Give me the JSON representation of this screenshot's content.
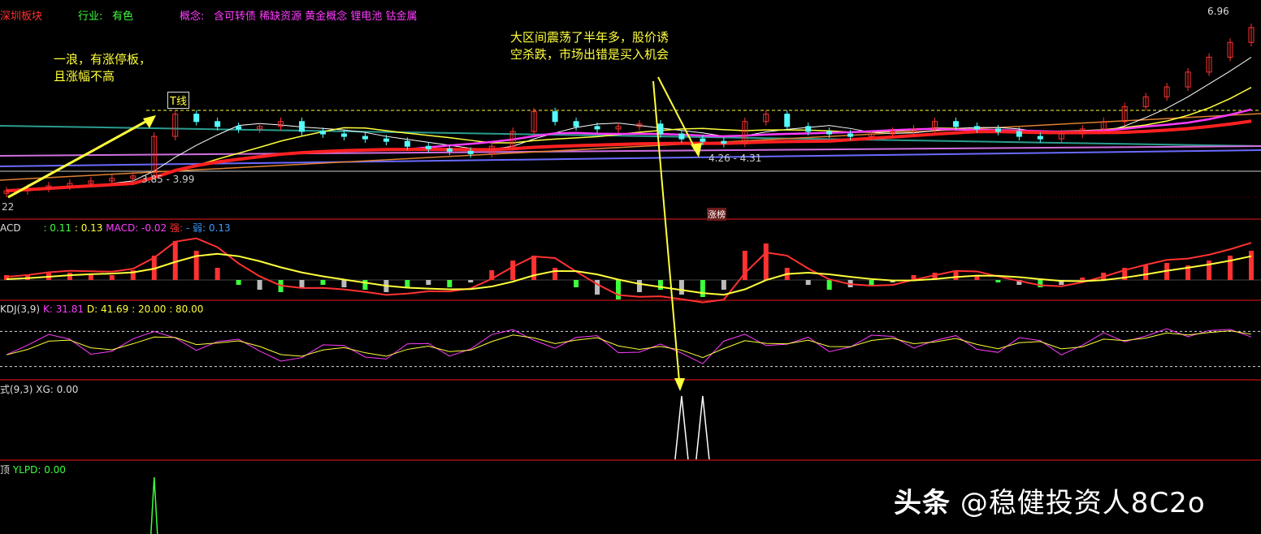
{
  "header": {
    "board": "深圳板块",
    "industry_label": "行业:",
    "industry": "有色",
    "concept_label": "概念:",
    "concepts": "含可转债 稀缺资源 黄金概念 锂电池 钴金属"
  },
  "annotations": {
    "wave_note": "一浪，有涨停板，\n且涨幅不高",
    "range_note": "大区间震荡了半年多，股价诱\n空杀跌，市场出错是买入机会",
    "t_line": "T线",
    "range_low_1": "3.85 - 3.99",
    "range_low_2": "4.26 - 4.31",
    "high_price": "6.96",
    "low_price": "22",
    "limit_up_badge": "涨榜",
    "watermark_bold": "头条",
    "watermark": "@稳健投资人8C2o"
  },
  "colors": {
    "up": "#ff3232",
    "down": "#54fcfc",
    "bg": "#000000",
    "separator": "#8b0000",
    "annotation": "#ffff3c"
  },
  "chart_data": [
    {
      "type": "candlestick",
      "panel": "main",
      "ylim": [
        3.22,
        6.96
      ],
      "close": [
        3.3,
        3.35,
        3.4,
        3.45,
        3.5,
        3.55,
        3.6,
        4.4,
        4.85,
        4.7,
        4.6,
        4.55,
        4.6,
        4.7,
        4.5,
        4.45,
        4.4,
        4.35,
        4.3,
        4.2,
        4.15,
        4.1,
        4.05,
        4.2,
        4.5,
        4.9,
        4.7,
        4.6,
        4.55,
        4.6,
        4.65,
        4.45,
        4.35,
        4.3,
        4.26,
        4.7,
        4.85,
        4.6,
        4.5,
        4.45,
        4.4,
        4.45,
        4.5,
        4.55,
        4.7,
        4.6,
        4.55,
        4.5,
        4.4,
        4.35,
        4.45,
        4.55,
        4.7,
        5.0,
        5.2,
        5.4,
        5.7,
        6.0,
        6.3,
        6.6
      ]
    },
    {
      "type": "bar",
      "panel": "macd",
      "legend": {
        "name": "ACD",
        "dif": ": 0.11",
        "dea": ": 0.13",
        "macd": "MACD: -0.02",
        "strong": "强:",
        "weak_sep": "-",
        "weak": "弱: 0.13"
      },
      "values": [
        0.02,
        0.02,
        0.03,
        0.03,
        0.02,
        0.02,
        0.04,
        0.1,
        0.16,
        0.12,
        0.05,
        -0.02,
        -0.04,
        -0.05,
        -0.03,
        -0.02,
        -0.03,
        -0.04,
        -0.05,
        -0.03,
        -0.02,
        -0.03,
        -0.01,
        0.04,
        0.08,
        0.1,
        0.05,
        -0.03,
        -0.06,
        -0.08,
        -0.05,
        -0.04,
        -0.06,
        -0.07,
        -0.04,
        0.12,
        0.15,
        0.05,
        -0.02,
        -0.04,
        -0.03,
        -0.02,
        -0.01,
        0.02,
        0.03,
        0.04,
        0.02,
        -0.01,
        -0.02,
        -0.03,
        -0.02,
        0.01,
        0.03,
        0.05,
        0.06,
        0.07,
        0.06,
        0.08,
        0.1,
        0.12
      ]
    },
    {
      "type": "line",
      "panel": "kdj",
      "legend": {
        "name": "KDJ(3,9)",
        "k": "K: 31.81",
        "d": "D: 41.69",
        "l1": ": 20.00",
        "l2": ": 80.00"
      },
      "ylim": [
        0,
        100
      ],
      "reference_lines": [
        20,
        80
      ],
      "k": [
        40,
        70,
        90,
        60,
        20,
        50,
        85,
        90,
        60,
        30,
        75,
        70,
        30,
        15,
        40,
        75,
        55,
        20,
        30,
        80,
        60,
        20,
        60,
        95,
        90,
        50,
        40,
        85,
        75,
        20,
        45,
        70,
        30,
        10,
        95,
        85,
        40,
        60,
        80,
        25,
        60,
        90,
        70,
        35,
        75,
        80,
        30,
        40,
        90,
        60,
        20,
        70,
        95,
        50,
        80,
        95,
        60,
        90,
        85,
        60
      ]
    },
    {
      "type": "line",
      "panel": "xg",
      "legend": {
        "name": "式(9,3)",
        "value": "XG: 0.00"
      },
      "spikes_at_index": [
        32,
        33
      ]
    },
    {
      "type": "line",
      "panel": "ylpd",
      "legend": {
        "name": "顶",
        "value": "YLPD: 0.00"
      },
      "spikes_at_index": [
        7
      ]
    }
  ]
}
